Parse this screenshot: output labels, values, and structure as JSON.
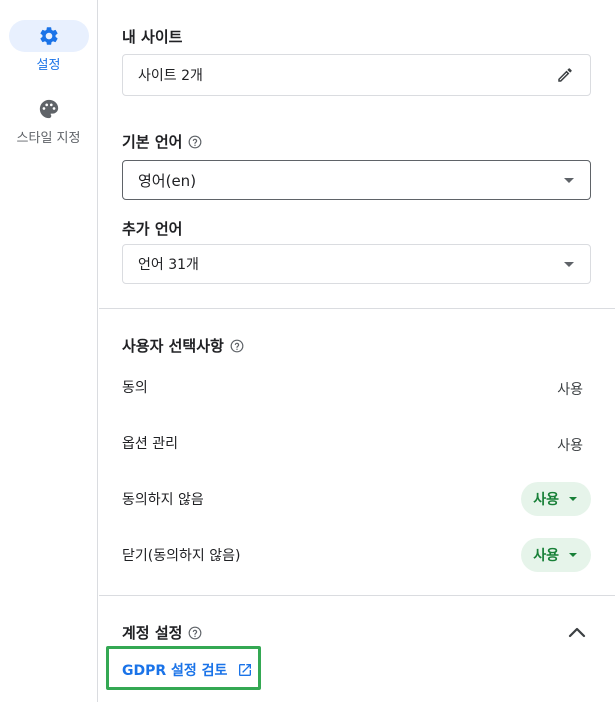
{
  "nav": {
    "items": [
      {
        "label": "설정",
        "icon": "gear-icon",
        "active": true
      },
      {
        "label": "스타일 지정",
        "icon": "palette-icon",
        "active": false
      }
    ]
  },
  "sites": {
    "title": "내 사이트",
    "value": "사이트 2개",
    "edit_icon": "pencil-icon"
  },
  "default_language": {
    "title": "기본 언어",
    "value": "영어(en)"
  },
  "additional_languages": {
    "title": "추가 언어",
    "value": "언어 31개"
  },
  "user_choices": {
    "title": "사용자 선택사항",
    "rows": [
      {
        "label": "동의",
        "value": "사용",
        "dropdown": false
      },
      {
        "label": "옵션 관리",
        "value": "사용",
        "dropdown": false
      },
      {
        "label": "동의하지 않음",
        "value": "사용",
        "dropdown": true
      },
      {
        "label": "닫기(동의하지 않음)",
        "value": "사용",
        "dropdown": true
      }
    ]
  },
  "account_settings": {
    "title": "계정 설정",
    "expanded": true,
    "link_label": "GDPR 설정 검토",
    "link_icon": "open-in-new-icon"
  },
  "colors": {
    "accent": "#1a73e8",
    "active_bg": "#e8f0fe",
    "chip_bg": "#e6f4ea",
    "chip_text": "#188038",
    "highlight_border": "#34a853",
    "divider": "#dadce0"
  }
}
